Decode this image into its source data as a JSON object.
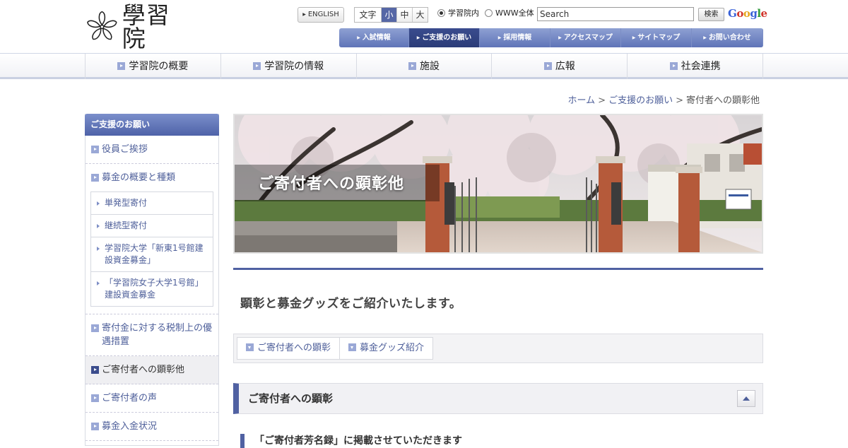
{
  "header": {
    "logo_text": "學習院",
    "english_label": "ENGLISH",
    "font_size": {
      "label": "文字",
      "options": [
        "小",
        "中",
        "大"
      ],
      "selected": "小"
    },
    "search_scope": [
      {
        "label": "学習院内",
        "checked": true
      },
      {
        "label": "WWW全体",
        "checked": false
      }
    ],
    "search_value": "Search",
    "search_button": "検索",
    "google_letters": [
      "G",
      "o",
      "o",
      "g",
      "l",
      "e"
    ],
    "google_colors": [
      "#3a62d8",
      "#d0352b",
      "#e6a61d",
      "#3a62d8",
      "#2f9a3b",
      "#d0352b"
    ]
  },
  "utility_nav": [
    {
      "label": "入試情報",
      "active": false
    },
    {
      "label": "ご支援のお願い",
      "active": true
    },
    {
      "label": "採用情報",
      "active": false
    },
    {
      "label": "アクセスマップ",
      "active": false
    },
    {
      "label": "サイトマップ",
      "active": false
    },
    {
      "label": "お問い合わせ",
      "active": false
    }
  ],
  "global_nav": [
    "学習院の概要",
    "学習院の情報",
    "施設",
    "広報",
    "社会連携"
  ],
  "breadcrumb": {
    "home": "ホーム",
    "parent": "ご支援のお願い",
    "current": "寄付者への顕彰他",
    "sep": ">"
  },
  "sidebar": {
    "title": "ご支援のお願い",
    "items": [
      {
        "label": "役員ご挨拶"
      },
      {
        "label": "募金の概要と種類"
      },
      {
        "label": "寄付金に対する税制上の優遇措置"
      },
      {
        "label": "ご寄付者への顕彰他"
      },
      {
        "label": "ご寄付者の声"
      },
      {
        "label": "募金入金状況"
      }
    ],
    "sub_items": [
      "単発型寄付",
      "継続型寄付",
      "学習院大学「新東1号館建設資金募金」",
      "「学習院女子大学1号館」建設資金募金"
    ]
  },
  "hero": {
    "title": "ご寄付者への顕彰他"
  },
  "lead": "顕彰と募金グッズをご紹介いたします。",
  "anchors": [
    "ご寄付者への顕彰",
    "募金グッズ紹介"
  ],
  "section": {
    "title": "ご寄付者への顕彰"
  },
  "sub_heading": "「ご寄付者芳名録」に掲載させていただきます",
  "colors": {
    "accent": "#5061a2",
    "link": "#4e5f9a",
    "nav_gradient_top": "#8ea0d3"
  }
}
